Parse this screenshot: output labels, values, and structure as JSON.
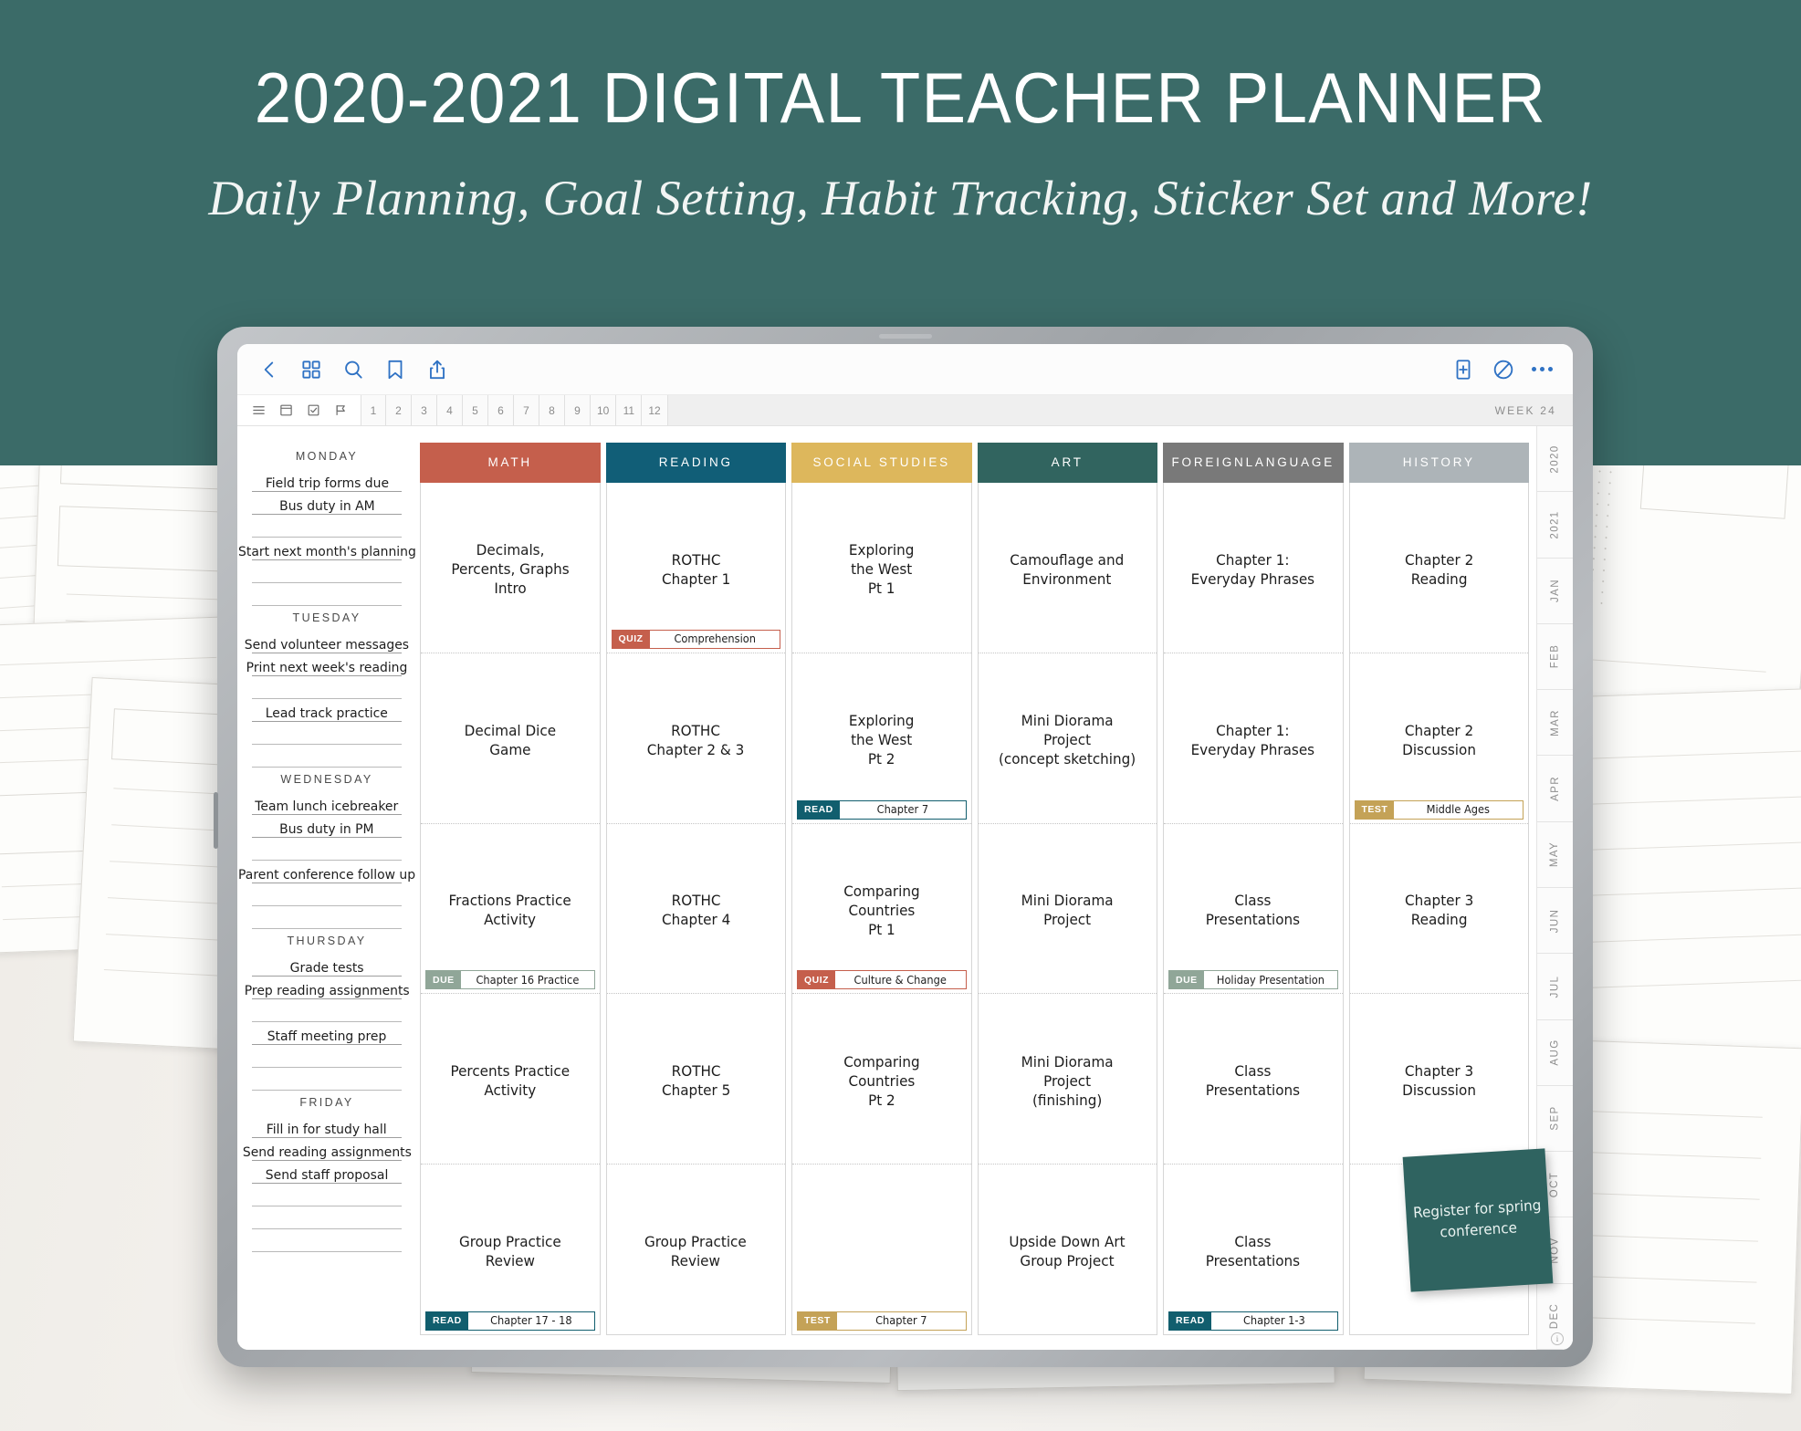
{
  "banner": {
    "title": "2020-2021 DIGITAL TEACHER PLANNER",
    "subtitle": "Daily Planning, Goal Setting, Habit Tracking, Sticker Set and More!",
    "bg_color": "#3b6b68"
  },
  "toolbar": {
    "back_icon": "chevron-left-icon",
    "grid_icon": "grid-icon",
    "search_icon": "search-icon",
    "bookmark_icon": "bookmark-icon",
    "share_icon": "share-icon",
    "add_page_icon": "add-page-icon",
    "annotate_icon": "annotate-icon",
    "more_icon": "more-options-icon"
  },
  "tabbar": {
    "icons": [
      "list-icon",
      "panel-icon",
      "checklist-icon",
      "flag-icon"
    ],
    "page_numbers": [
      "1",
      "2",
      "3",
      "4",
      "5",
      "6",
      "7",
      "8",
      "9",
      "10",
      "11",
      "12"
    ],
    "week_label": "WEEK 24"
  },
  "days": [
    {
      "name": "MONDAY",
      "tasks": [
        "Field trip forms due",
        "Bus duty in AM",
        "",
        "Start next month's planning",
        "",
        ""
      ]
    },
    {
      "name": "TUESDAY",
      "tasks": [
        "Send volunteer messages",
        "Print next week's reading",
        "",
        "Lead track practice",
        "",
        ""
      ]
    },
    {
      "name": "WEDNESDAY",
      "tasks": [
        "Team lunch icebreaker",
        "Bus duty in PM",
        "",
        "Parent conference follow up",
        "",
        ""
      ]
    },
    {
      "name": "THURSDAY",
      "tasks": [
        "Grade tests",
        "Prep reading assignments",
        "",
        "Staff meeting prep",
        "",
        ""
      ]
    },
    {
      "name": "FRIDAY",
      "tasks": [
        "Fill in for study hall",
        "Send reading assignments",
        "Send staff proposal",
        "",
        "",
        ""
      ]
    }
  ],
  "subjects": [
    {
      "name": "MATH",
      "color": "#c55f4c",
      "cells": [
        {
          "text": "Decimals,\nPercents, Graphs\nIntro",
          "tag": null
        },
        {
          "text": "Decimal Dice\nGame",
          "tag": null
        },
        {
          "text": "Fractions Practice\nActivity",
          "tag": {
            "label": "DUE",
            "value": "Chapter 16 Practice",
            "color": "#90a698"
          }
        },
        {
          "text": "Percents Practice\nActivity",
          "tag": null
        },
        {
          "text": "Group Practice\nReview",
          "tag": {
            "label": "READ",
            "value": "Chapter 17 - 18",
            "color": "#115e6e"
          }
        }
      ]
    },
    {
      "name": "READING",
      "color": "#115e77",
      "cells": [
        {
          "text": "ROTHC\nChapter 1",
          "tag": {
            "label": "QUIZ",
            "value": "Comprehension",
            "color": "#c55f4c"
          }
        },
        {
          "text": "ROTHC\nChapter 2 & 3",
          "tag": null
        },
        {
          "text": "ROTHC\nChapter 4",
          "tag": null
        },
        {
          "text": "ROTHC\nChapter 5",
          "tag": null
        },
        {
          "text": "Group Practice\nReview",
          "tag": null
        }
      ]
    },
    {
      "name": "SOCIAL STUDIES",
      "color": "#ddb75c",
      "cells": [
        {
          "text": "Exploring\nthe West\nPt 1",
          "tag": null
        },
        {
          "text": "Exploring\nthe West\nPt 2",
          "tag": {
            "label": "READ",
            "value": "Chapter 7",
            "color": "#115e6e"
          }
        },
        {
          "text": "Comparing\nCountries\nPt 1",
          "tag": {
            "label": "QUIZ",
            "value": "Culture & Change",
            "color": "#c55f4c"
          }
        },
        {
          "text": "Comparing\nCountries\nPt 2",
          "tag": null
        },
        {
          "text": "",
          "tag": {
            "label": "TEST",
            "value": "Chapter 7",
            "color": "#c4a257"
          }
        }
      ]
    },
    {
      "name": "ART",
      "color": "#31645f",
      "cells": [
        {
          "text": "Camouflage and\nEnvironment",
          "tag": null
        },
        {
          "text": "Mini Diorama\nProject\n(concept sketching)",
          "tag": null
        },
        {
          "text": "Mini Diorama\nProject",
          "tag": null
        },
        {
          "text": "Mini Diorama\nProject\n(finishing)",
          "tag": null
        },
        {
          "text": "Upside Down Art\nGroup Project",
          "tag": null
        }
      ]
    },
    {
      "name": "FOREIGN\nLANGUAGE",
      "color": "#797979",
      "cells": [
        {
          "text": "Chapter 1:\nEveryday Phrases",
          "tag": null
        },
        {
          "text": "Chapter 1:\nEveryday Phrases",
          "tag": null
        },
        {
          "text": "Class\nPresentations",
          "tag": {
            "label": "DUE",
            "value": "Holiday Presentation",
            "color": "#90a698"
          }
        },
        {
          "text": "Class\nPresentations",
          "tag": null
        },
        {
          "text": "Class\nPresentations",
          "tag": {
            "label": "READ",
            "value": "Chapter 1-3",
            "color": "#115e6e"
          }
        }
      ]
    },
    {
      "name": "HISTORY",
      "color": "#adb4b8",
      "cells": [
        {
          "text": "Chapter 2\nReading",
          "tag": null
        },
        {
          "text": "Chapter 2\nDiscussion",
          "tag": {
            "label": "TEST",
            "value": "Middle Ages",
            "color": "#c4a257"
          }
        },
        {
          "text": "Chapter 3\nReading",
          "tag": null
        },
        {
          "text": "Chapter 3\nDiscussion",
          "tag": null
        },
        {
          "text": "",
          "tag": null
        }
      ]
    }
  ],
  "sticky_note": {
    "text": "Register for spring conference",
    "color": "#2f6360"
  },
  "rail": {
    "items": [
      "2020",
      "2021",
      "JAN",
      "FEB",
      "MAR",
      "APR",
      "MAY",
      "JUN",
      "JUL",
      "AUG",
      "SEP",
      "OCT",
      "NOV",
      "DEC"
    ]
  },
  "footer": {
    "info_icon": "info-icon",
    "info_glyph": "i"
  }
}
